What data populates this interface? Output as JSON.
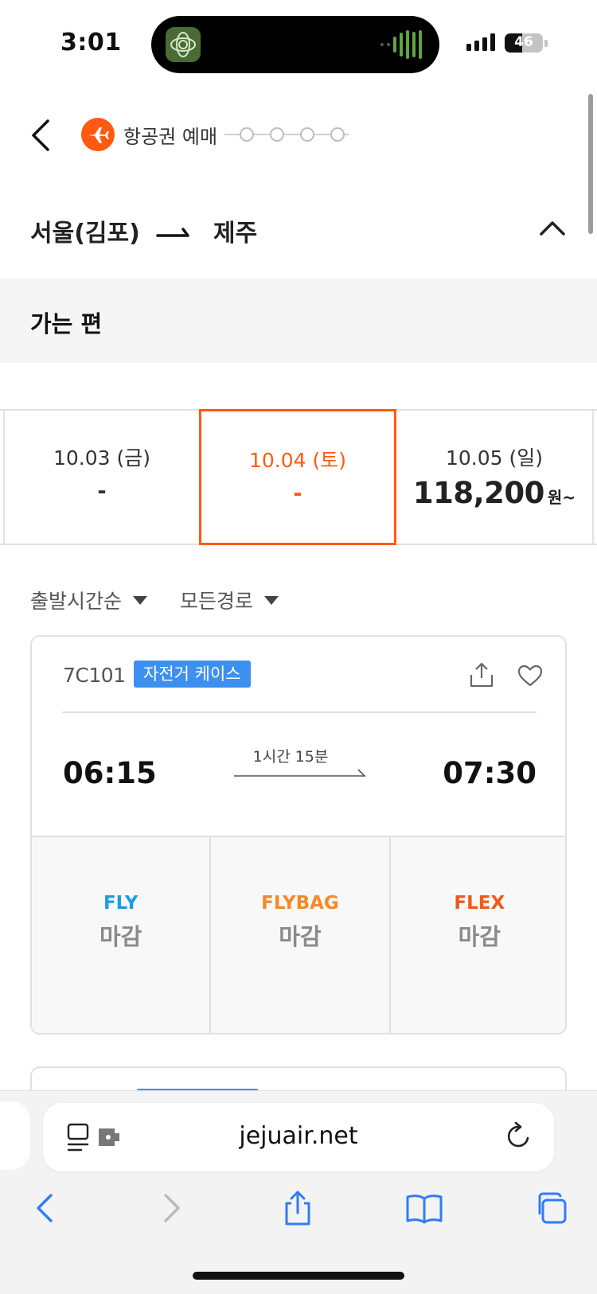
{
  "status_bar": {
    "time": "3:01",
    "battery_text": "46",
    "battery_level": 0.46
  },
  "header": {
    "title": "항공권 예매",
    "step_count": 4
  },
  "route": {
    "from": "서울(김포)",
    "to": "제주"
  },
  "section": {
    "title": "가는 편"
  },
  "dates": [
    {
      "date": "10.03 (금)",
      "price": "-",
      "unit": "",
      "selected": false
    },
    {
      "date": "10.04 (토)",
      "price": "-",
      "unit": "",
      "selected": true
    },
    {
      "date": "10.05 (일)",
      "price": "118,200",
      "unit": "원~",
      "selected": false
    }
  ],
  "filters": {
    "sort": "출발시간순",
    "route": "모든경로"
  },
  "flight": {
    "number": "7C101",
    "tag": "자전거 케이스",
    "departure": "06:15",
    "arrival": "07:30",
    "duration": "1시간 15분",
    "fares": [
      {
        "name": "FLY",
        "status": "마감",
        "color": "#1a9ee0"
      },
      {
        "name": "FLYBAG",
        "status": "마감",
        "color": "#f28a2a"
      },
      {
        "name": "FLEX",
        "status": "마감",
        "color": "#f2581a"
      }
    ]
  },
  "browser": {
    "url": "jejuair.net"
  },
  "colors": {
    "brand": "#ff5a0f",
    "tag": "#3d8ff0",
    "ios_blue": "#2f7cf6"
  }
}
